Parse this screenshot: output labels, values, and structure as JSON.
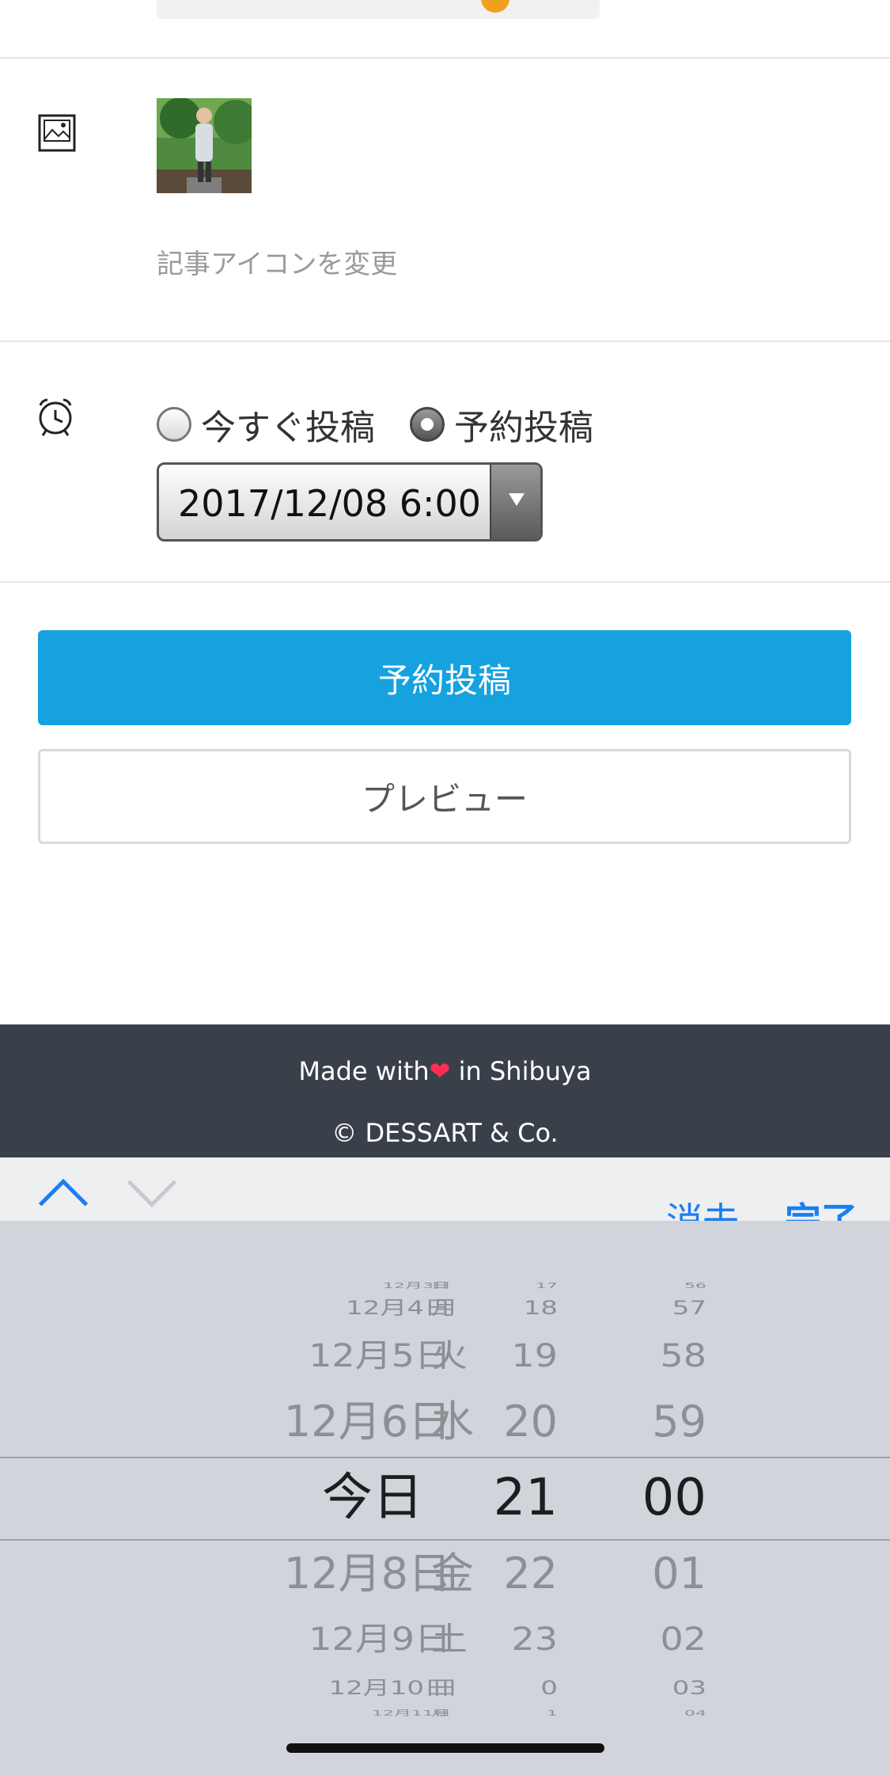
{
  "icon_row": {
    "change_icon_link": "記事アイコンを変更"
  },
  "schedule": {
    "options": [
      {
        "label": "今すぐ投稿",
        "selected": false
      },
      {
        "label": "予約投稿",
        "selected": true
      }
    ],
    "datetime_value": "2017/12/08 6:00"
  },
  "buttons": {
    "primary": "予約投稿",
    "preview": "プレビュー"
  },
  "footer": {
    "made_with_prefix": "Made with",
    "made_with_suffix": " in Shibuya",
    "heart": "❤",
    "copyright": "© DESSART & Co."
  },
  "toolbar": {
    "clear": "消去",
    "done": "完了"
  },
  "picker": {
    "rows": [
      {
        "date": "12月3日",
        "wday": "日",
        "hour": "17",
        "minute": "56"
      },
      {
        "date": "12月4日",
        "wday": "月",
        "hour": "18",
        "minute": "57"
      },
      {
        "date": "12月5日",
        "wday": "火",
        "hour": "19",
        "minute": "58"
      },
      {
        "date": "12月6日",
        "wday": "水",
        "hour": "20",
        "minute": "59"
      },
      {
        "date": "今日",
        "wday": "",
        "hour": "21",
        "minute": "00"
      },
      {
        "date": "12月8日",
        "wday": "金",
        "hour": "22",
        "minute": "01"
      },
      {
        "date": "12月9日",
        "wday": "土",
        "hour": "23",
        "minute": "02"
      },
      {
        "date": "12月10日",
        "wday": "日",
        "hour": "0",
        "minute": "03"
      },
      {
        "date": "12月11日",
        "wday": "月",
        "hour": "1",
        "minute": "04"
      }
    ]
  },
  "colors": {
    "primary_button": "#15a2de",
    "footer_bg": "#3a404a",
    "ios_blue": "#1a7ef0",
    "picker_bg": "#d1d4da"
  }
}
